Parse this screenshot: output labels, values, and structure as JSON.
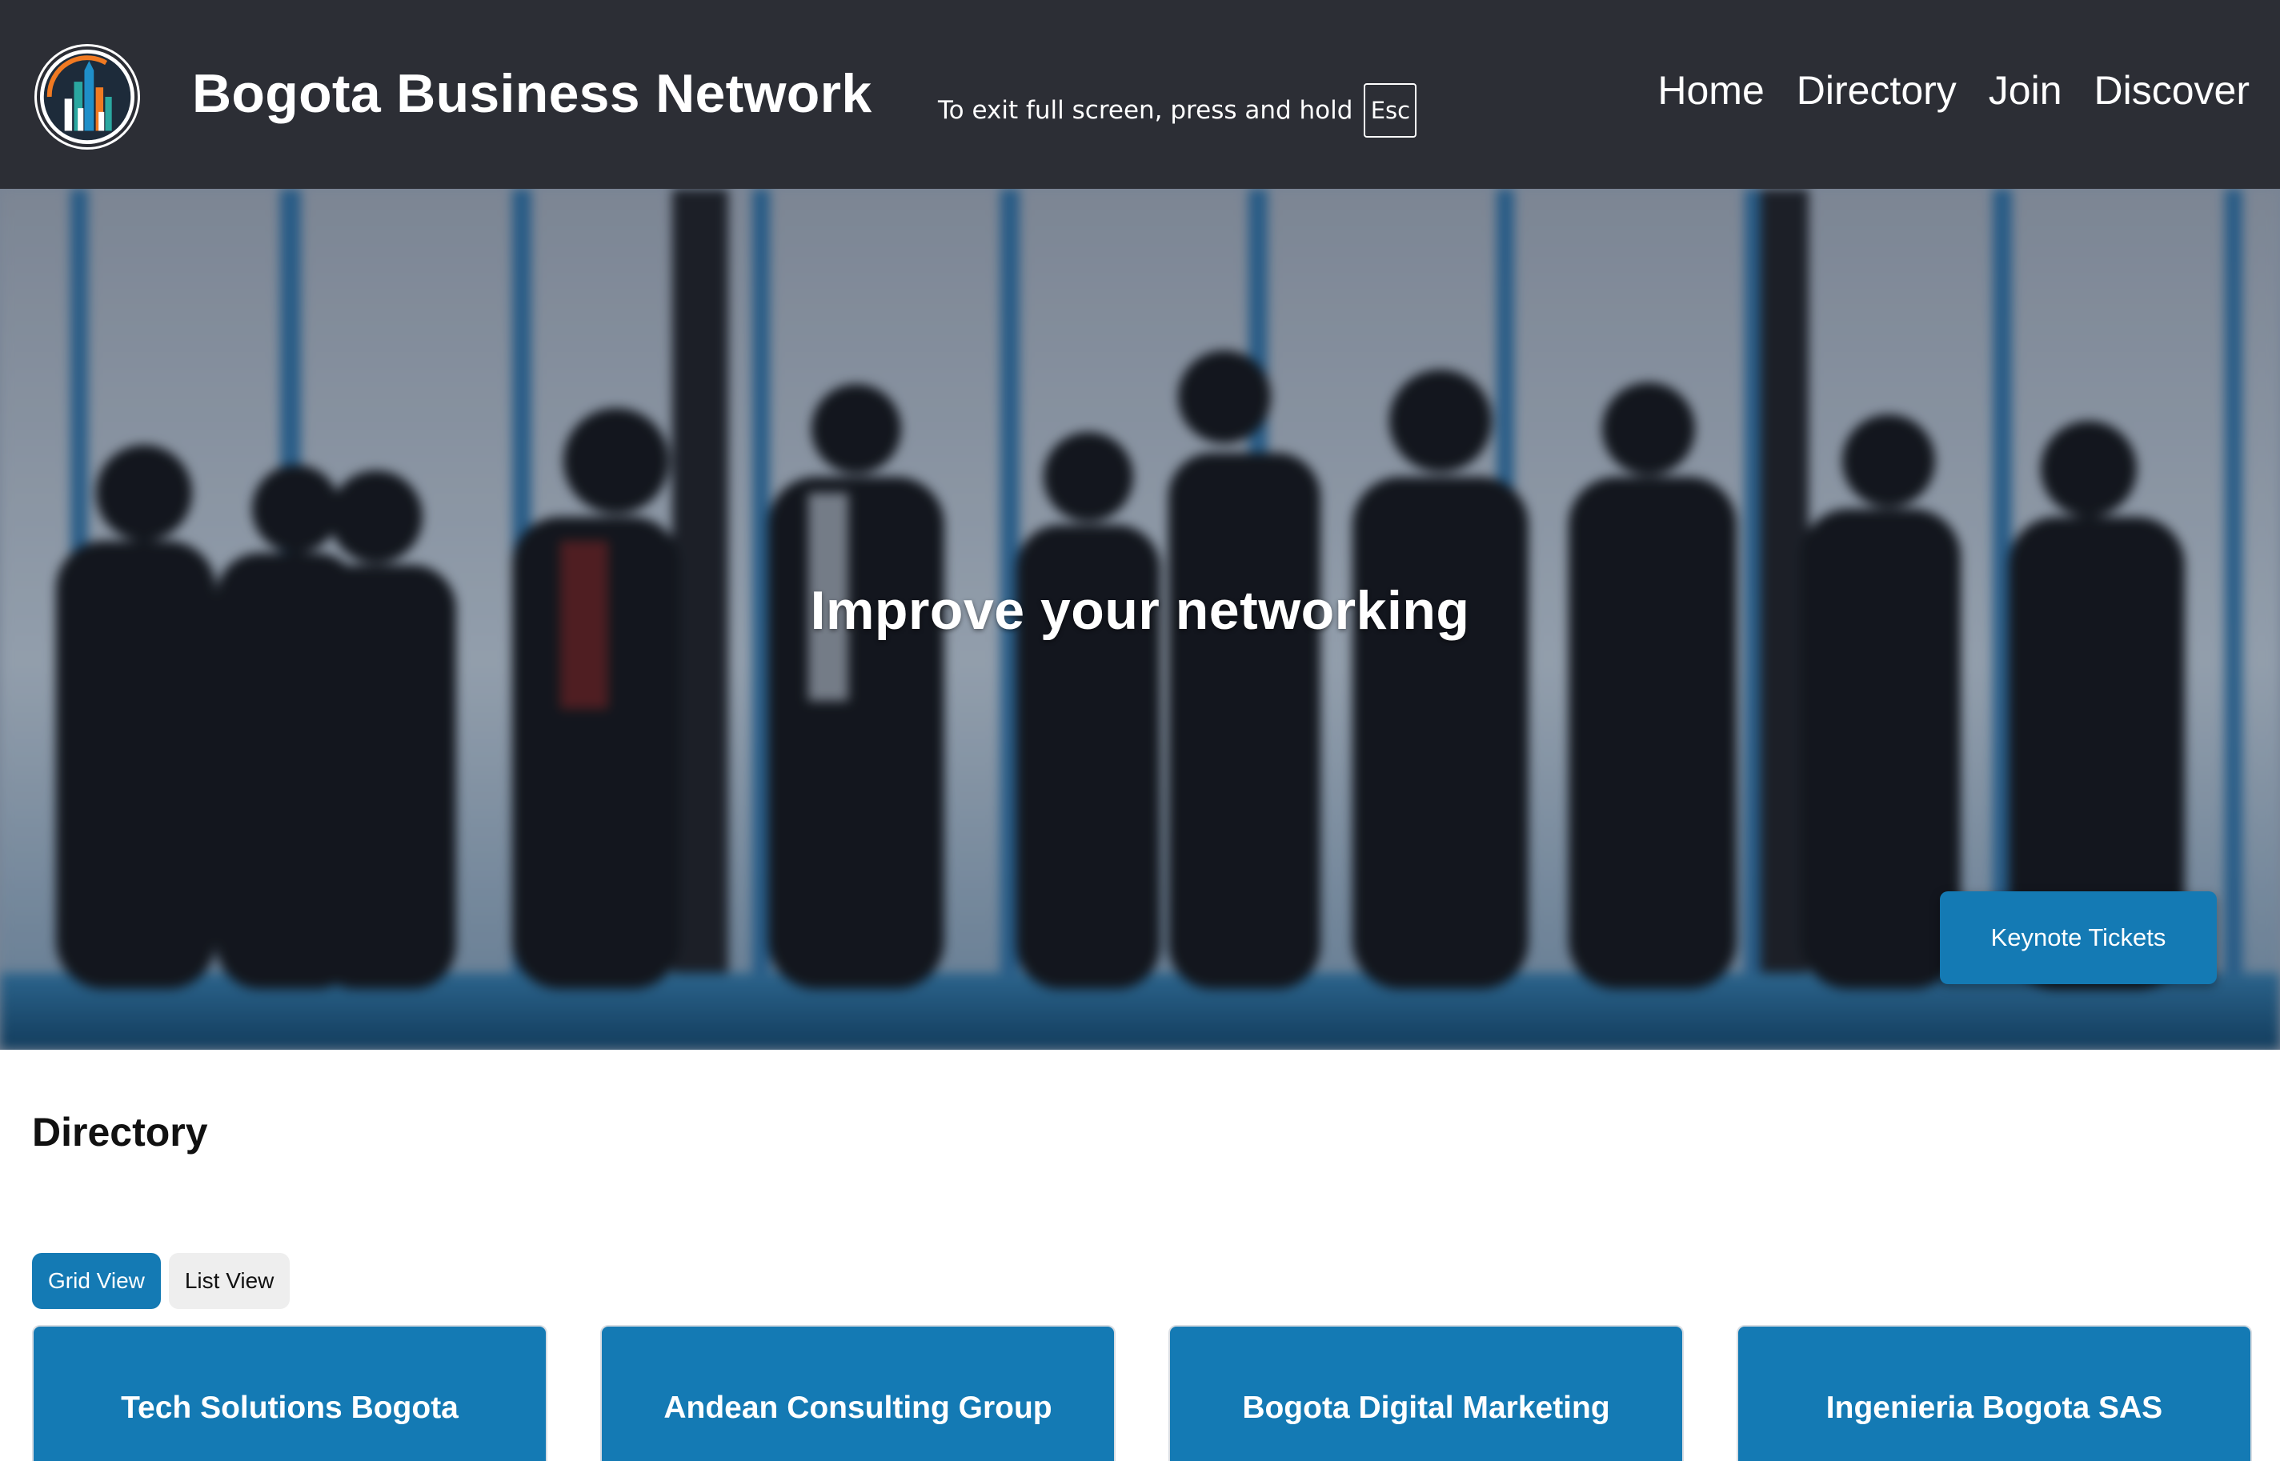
{
  "header": {
    "site_title": "Bogota Business Network",
    "logo_icon": "city-skyline-logo",
    "fullscreen_hint": "To exit full screen, press and hold",
    "fullscreen_key": "Esc",
    "nav": [
      {
        "label": "Home"
      },
      {
        "label": "Directory"
      },
      {
        "label": "Join"
      },
      {
        "label": "Discover"
      }
    ]
  },
  "hero": {
    "heading": "Improve your networking",
    "cta_label": "Keynote Tickets",
    "image": "silhouettes-of-business-people-networking"
  },
  "directory": {
    "title": "Directory",
    "views": [
      {
        "label": "Grid View",
        "active": true
      },
      {
        "label": "List View",
        "active": false
      }
    ],
    "cards": [
      {
        "name": "Tech Solutions Bogota"
      },
      {
        "name": "Andean Consulting Group"
      },
      {
        "name": "Bogota Digital Marketing"
      },
      {
        "name": "Ingenieria Bogota SAS"
      }
    ]
  },
  "colors": {
    "header_bg": "#2c2e35",
    "accent": "#147ab4",
    "toggle_inactive": "#eeeeee"
  }
}
